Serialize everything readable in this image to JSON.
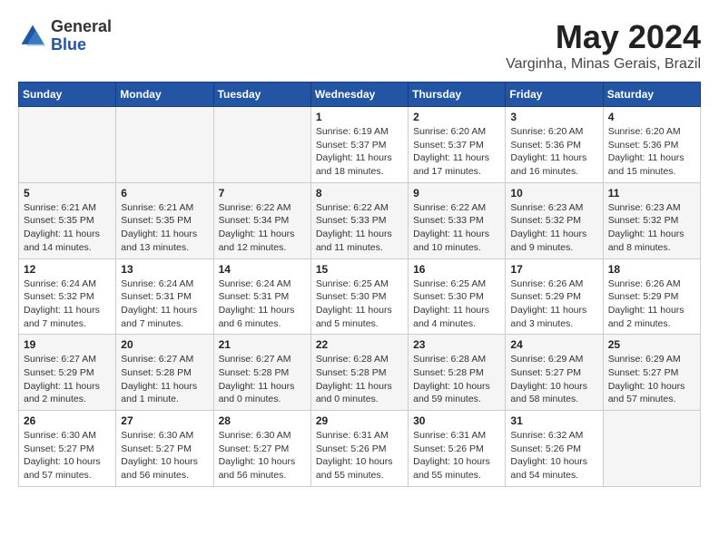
{
  "header": {
    "logo_line1": "General",
    "logo_line2": "Blue",
    "title": "May 2024",
    "location": "Varginha, Minas Gerais, Brazil"
  },
  "weekdays": [
    "Sunday",
    "Monday",
    "Tuesday",
    "Wednesday",
    "Thursday",
    "Friday",
    "Saturday"
  ],
  "weeks": [
    [
      {
        "day": "",
        "info": ""
      },
      {
        "day": "",
        "info": ""
      },
      {
        "day": "",
        "info": ""
      },
      {
        "day": "1",
        "info": "Sunrise: 6:19 AM\nSunset: 5:37 PM\nDaylight: 11 hours and 18 minutes."
      },
      {
        "day": "2",
        "info": "Sunrise: 6:20 AM\nSunset: 5:37 PM\nDaylight: 11 hours and 17 minutes."
      },
      {
        "day": "3",
        "info": "Sunrise: 6:20 AM\nSunset: 5:36 PM\nDaylight: 11 hours and 16 minutes."
      },
      {
        "day": "4",
        "info": "Sunrise: 6:20 AM\nSunset: 5:36 PM\nDaylight: 11 hours and 15 minutes."
      }
    ],
    [
      {
        "day": "5",
        "info": "Sunrise: 6:21 AM\nSunset: 5:35 PM\nDaylight: 11 hours and 14 minutes."
      },
      {
        "day": "6",
        "info": "Sunrise: 6:21 AM\nSunset: 5:35 PM\nDaylight: 11 hours and 13 minutes."
      },
      {
        "day": "7",
        "info": "Sunrise: 6:22 AM\nSunset: 5:34 PM\nDaylight: 11 hours and 12 minutes."
      },
      {
        "day": "8",
        "info": "Sunrise: 6:22 AM\nSunset: 5:33 PM\nDaylight: 11 hours and 11 minutes."
      },
      {
        "day": "9",
        "info": "Sunrise: 6:22 AM\nSunset: 5:33 PM\nDaylight: 11 hours and 10 minutes."
      },
      {
        "day": "10",
        "info": "Sunrise: 6:23 AM\nSunset: 5:32 PM\nDaylight: 11 hours and 9 minutes."
      },
      {
        "day": "11",
        "info": "Sunrise: 6:23 AM\nSunset: 5:32 PM\nDaylight: 11 hours and 8 minutes."
      }
    ],
    [
      {
        "day": "12",
        "info": "Sunrise: 6:24 AM\nSunset: 5:32 PM\nDaylight: 11 hours and 7 minutes."
      },
      {
        "day": "13",
        "info": "Sunrise: 6:24 AM\nSunset: 5:31 PM\nDaylight: 11 hours and 7 minutes."
      },
      {
        "day": "14",
        "info": "Sunrise: 6:24 AM\nSunset: 5:31 PM\nDaylight: 11 hours and 6 minutes."
      },
      {
        "day": "15",
        "info": "Sunrise: 6:25 AM\nSunset: 5:30 PM\nDaylight: 11 hours and 5 minutes."
      },
      {
        "day": "16",
        "info": "Sunrise: 6:25 AM\nSunset: 5:30 PM\nDaylight: 11 hours and 4 minutes."
      },
      {
        "day": "17",
        "info": "Sunrise: 6:26 AM\nSunset: 5:29 PM\nDaylight: 11 hours and 3 minutes."
      },
      {
        "day": "18",
        "info": "Sunrise: 6:26 AM\nSunset: 5:29 PM\nDaylight: 11 hours and 2 minutes."
      }
    ],
    [
      {
        "day": "19",
        "info": "Sunrise: 6:27 AM\nSunset: 5:29 PM\nDaylight: 11 hours and 2 minutes."
      },
      {
        "day": "20",
        "info": "Sunrise: 6:27 AM\nSunset: 5:28 PM\nDaylight: 11 hours and 1 minute."
      },
      {
        "day": "21",
        "info": "Sunrise: 6:27 AM\nSunset: 5:28 PM\nDaylight: 11 hours and 0 minutes."
      },
      {
        "day": "22",
        "info": "Sunrise: 6:28 AM\nSunset: 5:28 PM\nDaylight: 11 hours and 0 minutes."
      },
      {
        "day": "23",
        "info": "Sunrise: 6:28 AM\nSunset: 5:28 PM\nDaylight: 10 hours and 59 minutes."
      },
      {
        "day": "24",
        "info": "Sunrise: 6:29 AM\nSunset: 5:27 PM\nDaylight: 10 hours and 58 minutes."
      },
      {
        "day": "25",
        "info": "Sunrise: 6:29 AM\nSunset: 5:27 PM\nDaylight: 10 hours and 57 minutes."
      }
    ],
    [
      {
        "day": "26",
        "info": "Sunrise: 6:30 AM\nSunset: 5:27 PM\nDaylight: 10 hours and 57 minutes."
      },
      {
        "day": "27",
        "info": "Sunrise: 6:30 AM\nSunset: 5:27 PM\nDaylight: 10 hours and 56 minutes."
      },
      {
        "day": "28",
        "info": "Sunrise: 6:30 AM\nSunset: 5:27 PM\nDaylight: 10 hours and 56 minutes."
      },
      {
        "day": "29",
        "info": "Sunrise: 6:31 AM\nSunset: 5:26 PM\nDaylight: 10 hours and 55 minutes."
      },
      {
        "day": "30",
        "info": "Sunrise: 6:31 AM\nSunset: 5:26 PM\nDaylight: 10 hours and 55 minutes."
      },
      {
        "day": "31",
        "info": "Sunrise: 6:32 AM\nSunset: 5:26 PM\nDaylight: 10 hours and 54 minutes."
      },
      {
        "day": "",
        "info": ""
      }
    ]
  ]
}
